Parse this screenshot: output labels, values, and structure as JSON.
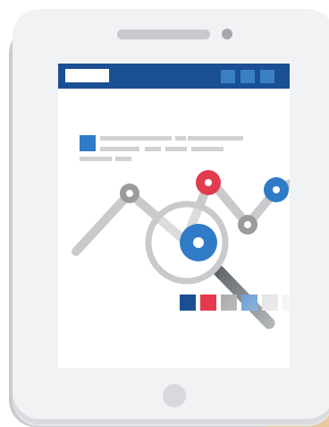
{
  "illustration": {
    "subject": "tablet-with-line-chart-and-magnifier",
    "colors": {
      "header": "#1b4f93",
      "accent_blue": "#2f7bc6",
      "accent_red": "#e23b4e",
      "chart_gray": "#c9cacc",
      "node_gray": "#9a9b9d",
      "magnifier_handle": "#5b6166",
      "hand": "#e8c99c"
    },
    "swatches": [
      {
        "name": "navy",
        "color": "#1b4f93"
      },
      {
        "name": "red",
        "color": "#e23b4e"
      },
      {
        "name": "gray",
        "color": "#9a9b9d"
      },
      {
        "name": "blue",
        "color": "#3a7fc4"
      },
      {
        "name": "light-gray",
        "color": "#d6d7d9"
      },
      {
        "name": "pale-gray",
        "color": "#ececed"
      }
    ],
    "header_tiles": 3,
    "chart_nodes": [
      "gray",
      "blue",
      "red",
      "gray",
      "blue"
    ]
  }
}
